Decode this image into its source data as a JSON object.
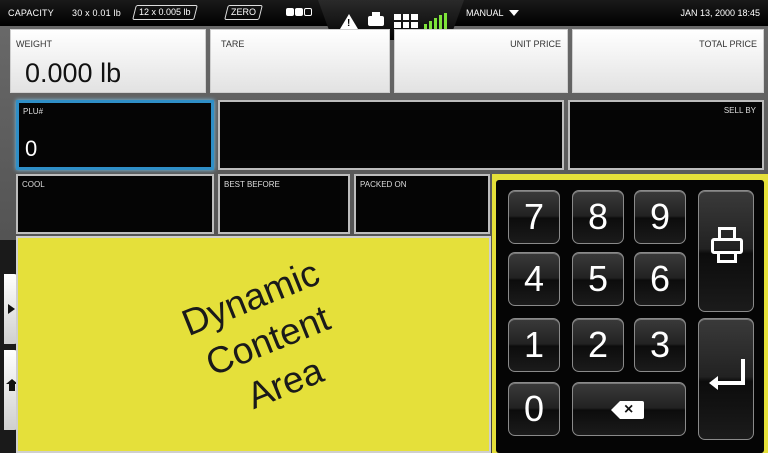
{
  "status_bar": {
    "capacity_label": "CAPACITY",
    "capacity_value": "30 x 0.01 lb",
    "increment": "12 x 0.005 lb",
    "zero_label": "ZERO",
    "mode_label": "MANUAL",
    "datetime": "JAN 13, 2000 18:45",
    "icons": [
      "warning-icon",
      "printer-icon",
      "grid-icon",
      "signal-icon"
    ]
  },
  "weight_row": {
    "weight_label": "WEIGHT",
    "weight_value": "0.000 lb",
    "tare_label": "TARE",
    "unit_price_label": "UNIT PRICE",
    "total_price_label": "TOTAL PRICE"
  },
  "fields": {
    "plu_label": "PLU#",
    "plu_value": "0",
    "sell_by_label": "SELL BY",
    "cool_label": "COOL",
    "best_before_label": "BEST BEFORE",
    "packed_on_label": "PACKED ON"
  },
  "content": {
    "line1": "Dynamic",
    "line2": "Content",
    "line3": "Area"
  },
  "keypad": {
    "keys": [
      "7",
      "8",
      "9",
      "4",
      "5",
      "6",
      "1",
      "2",
      "3",
      "0"
    ],
    "backspace_symbol": "×"
  },
  "colors": {
    "accent_yellow": "#e5e03a",
    "focus_blue": "#2f8fc7",
    "signal_green": "#7ee33a"
  }
}
